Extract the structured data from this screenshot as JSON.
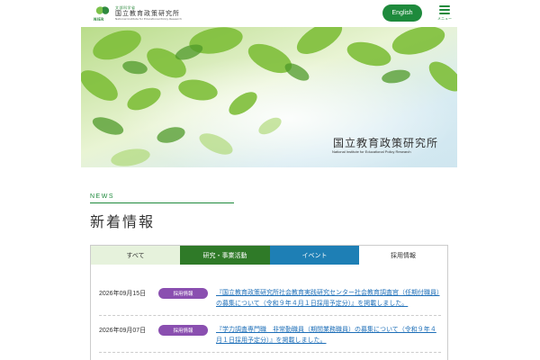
{
  "header": {
    "logo_small": "文部科学省",
    "logo_main": "国立教育政策研究所",
    "logo_en": "National Institute for Educational Policy Research",
    "logo_abbr": "NIER",
    "english_label": "English",
    "menu_label": "メニュー"
  },
  "hero": {
    "title": "国立教育政策研究所",
    "subtitle": "National Institute for Educational Policy Research"
  },
  "news": {
    "label": "NEWS",
    "title": "新着情報",
    "tabs": [
      {
        "label": "すべて"
      },
      {
        "label": "研究・事業活動"
      },
      {
        "label": "イベント"
      },
      {
        "label": "採用情報"
      }
    ],
    "items": [
      {
        "date": "2026年09月15日",
        "badge": "採用情報",
        "text": "『国立教育政策研究所社会教育実践研究センター社会教育調査官（任期付職員）の募集について（令和９年４月１日採用予定分）』を掲載しました。"
      },
      {
        "date": "2026年09月07日",
        "badge": "採用情報",
        "text": "『学力調査専門職　非常勤職員（期間業務職員）の募集について（令和９年４月１日採用予定分）』を掲載しました。"
      }
    ]
  },
  "colors": {
    "brand_green": "#1e8a3c",
    "tab_research": "#2f7a28",
    "tab_event": "#1e7fb5",
    "badge_purple": "#8a4fb0",
    "link_blue": "#1e6fb8"
  }
}
